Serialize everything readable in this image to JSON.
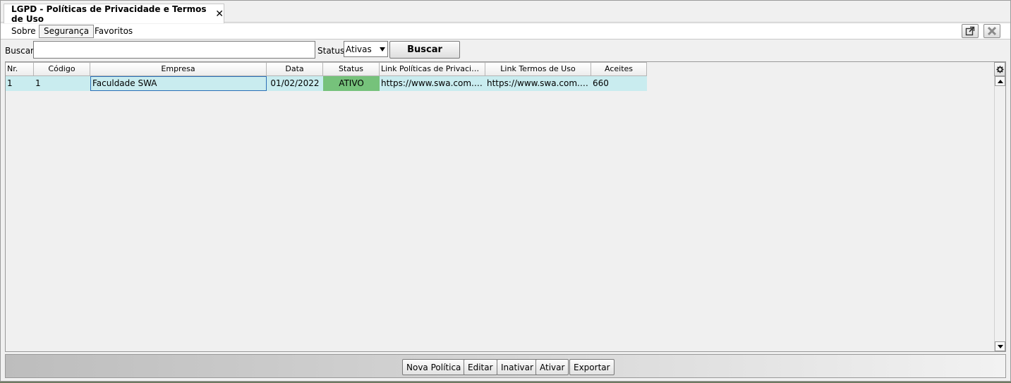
{
  "tab": {
    "title": "LGPD - Políticas de Privacidade e Termos de Uso",
    "close_glyph": "✕"
  },
  "menu": {
    "items": [
      "Sobre",
      "Segurança",
      "Favoritos"
    ]
  },
  "search": {
    "label": "Buscar:",
    "value": "",
    "placeholder": "",
    "status_label": "Status:",
    "status_selected": "Ativas",
    "button_label": "Buscar"
  },
  "table": {
    "headers": [
      "Nr.",
      "Código",
      "Empresa",
      "Data",
      "Status",
      "Link Políticas de Privacid...",
      "Link Termos de Uso",
      "Aceites"
    ],
    "rows": [
      {
        "nr": "1",
        "codigo": "1",
        "empresa": "Faculdade SWA",
        "data": "01/02/2022",
        "status": "ATIVO",
        "link_politicas": "https://www.swa.com.br/...",
        "link_termos": "https://www.swa.com.br/...",
        "aceites": "660"
      }
    ]
  },
  "actions": {
    "nova_politica": "Nova Política",
    "editar": "Editar",
    "inativar": "Inativar",
    "ativar": "Ativar",
    "exportar": "Exportar"
  },
  "icons": {
    "popout": "external-window-icon",
    "close": "close-icon",
    "settings": "gear-icon"
  },
  "colors": {
    "row_bg": "#c9ecef",
    "status_active": "#76c27b",
    "selection_border": "#2b6fb6"
  }
}
